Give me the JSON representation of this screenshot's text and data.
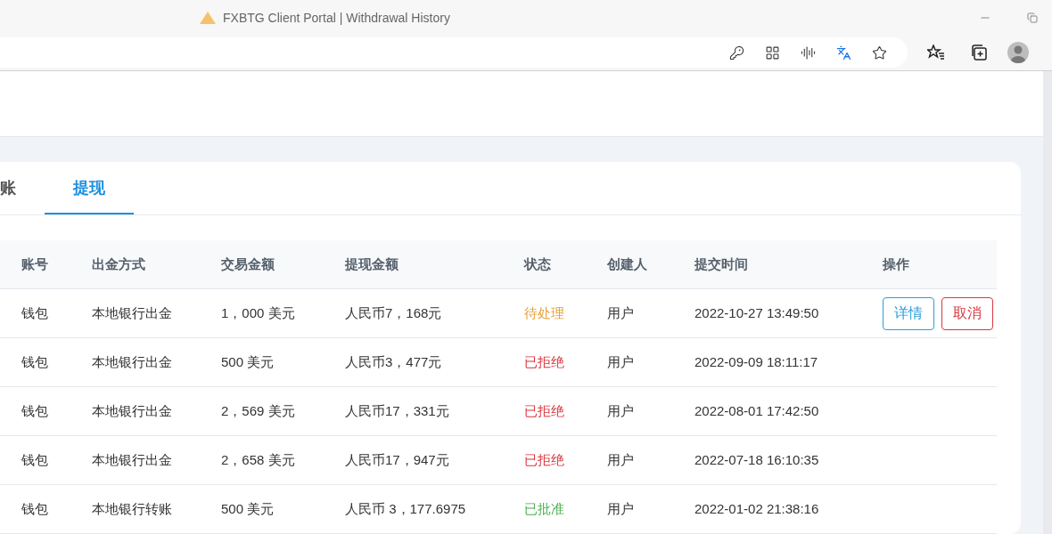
{
  "window": {
    "title": "FXBTG Client Portal | Withdrawal History"
  },
  "tabs": [
    {
      "label": "账",
      "selected": false
    },
    {
      "label": "提现",
      "selected": true
    }
  ],
  "table": {
    "columns": [
      "账号",
      "出金方式",
      "交易金额",
      "提现金额",
      "状态",
      "创建人",
      "提交时间",
      "操作"
    ],
    "rows": [
      {
        "account": "钱包",
        "method": "本地银行出金",
        "amount": "1，000 美元",
        "withdrawal": "人民币7，168元",
        "status": "待处理",
        "kind": "pending",
        "creator": "用户",
        "time": "2022-10-27 13:49:50",
        "actions": [
          {
            "label": "详情",
            "kind": "primary"
          },
          {
            "label": "取消",
            "kind": "danger"
          }
        ]
      },
      {
        "account": "钱包",
        "method": "本地银行出金",
        "amount": "500 美元",
        "withdrawal": "人民币3，477元",
        "status": "已拒绝",
        "kind": "rejected",
        "creator": "用户",
        "time": "2022-09-09 18:11:17",
        "actions": []
      },
      {
        "account": "钱包",
        "method": "本地银行出金",
        "amount": "2，569 美元",
        "withdrawal": "人民币17，331元",
        "status": "已拒绝",
        "kind": "rejected",
        "creator": "用户",
        "time": "2022-08-01 17:42:50",
        "actions": []
      },
      {
        "account": "钱包",
        "method": "本地银行出金",
        "amount": "2，658 美元",
        "withdrawal": "人民币17，947元",
        "status": "已拒绝",
        "kind": "rejected",
        "creator": "用户",
        "time": "2022-07-18 16:10:35",
        "actions": []
      },
      {
        "account": "钱包",
        "method": "本地银行转账",
        "amount": "500 美元",
        "withdrawal": "人民币 3，177.6975",
        "status": "已批准",
        "kind": "approved",
        "creator": "用户",
        "time": "2022-01-02 21:38:16",
        "actions": []
      }
    ]
  }
}
